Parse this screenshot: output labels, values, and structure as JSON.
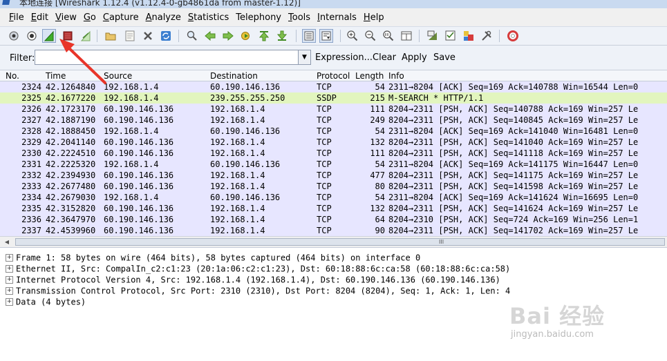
{
  "window": {
    "title": "本地连接 [Wireshark 1.12.4 (v1.12.4-0-gb4861da from master-1.12)]"
  },
  "menu": [
    {
      "underline": "F",
      "rest": "ile"
    },
    {
      "underline": "E",
      "rest": "dit"
    },
    {
      "underline": "V",
      "rest": "iew"
    },
    {
      "underline": "G",
      "rest": "o"
    },
    {
      "underline": "C",
      "rest": "apture"
    },
    {
      "underline": "A",
      "rest": "nalyze"
    },
    {
      "underline": "S",
      "rest": "tatistics"
    },
    {
      "underline": "",
      "rest": "Telephony"
    },
    {
      "underline": "T",
      "rest": "ools"
    },
    {
      "underline": "I",
      "rest": "nternals"
    },
    {
      "underline": "H",
      "rest": "elp"
    }
  ],
  "toolbar": {
    "icons": [
      "interfaces-icon",
      "capture-options-icon",
      "start-capture-icon",
      "stop-capture-icon",
      "restart-capture-icon",
      "open-file-icon",
      "save-file-icon",
      "close-file-icon",
      "reload-icon",
      "find-icon",
      "go-back-icon",
      "go-forward-icon",
      "go-to-packet-icon",
      "go-first-icon",
      "go-last-icon",
      "colorize-icon",
      "autoscroll-icon",
      "zoom-in-icon",
      "zoom-out-icon",
      "zoom-normal-icon",
      "resize-columns-icon",
      "capture-filters-icon",
      "display-filters-icon",
      "coloring-rules-icon",
      "preferences-icon",
      "help-icon"
    ]
  },
  "filter": {
    "label": "Filter:",
    "value": "",
    "expression_label": "Expression...",
    "clear_label": "Clear",
    "apply_label": "Apply",
    "save_label": "Save"
  },
  "packet_list": {
    "columns": [
      "No.",
      "Time",
      "Source",
      "Destination",
      "Protocol",
      "Length",
      "Info"
    ],
    "rows": [
      {
        "no": "2324",
        "time": "42.1264840",
        "src": "192.168.1.4",
        "dst": "60.190.146.136",
        "proto": "TCP",
        "len": "54",
        "info": "2311→8204 [ACK] Seq=169 Ack=140788 Win=16544 Len=0",
        "bg": "#e7e6ff"
      },
      {
        "no": "2325",
        "time": "42.1677220",
        "src": "192.168.1.4",
        "dst": "239.255.255.250",
        "proto": "SSDP",
        "len": "215",
        "info": "M-SEARCH * HTTP/1.1",
        "bg": "#e2f5be"
      },
      {
        "no": "2326",
        "time": "42.1723170",
        "src": "60.190.146.136",
        "dst": "192.168.1.4",
        "proto": "TCP",
        "len": "111",
        "info": "8204→2311 [PSH, ACK] Seq=140788 Ack=169 Win=257 Le",
        "bg": "#e7e6ff"
      },
      {
        "no": "2327",
        "time": "42.1887190",
        "src": "60.190.146.136",
        "dst": "192.168.1.4",
        "proto": "TCP",
        "len": "249",
        "info": "8204→2311 [PSH, ACK] Seq=140845 Ack=169 Win=257 Le",
        "bg": "#e7e6ff"
      },
      {
        "no": "2328",
        "time": "42.1888450",
        "src": "192.168.1.4",
        "dst": "60.190.146.136",
        "proto": "TCP",
        "len": "54",
        "info": "2311→8204 [ACK] Seq=169 Ack=141040 Win=16481 Len=0",
        "bg": "#e7e6ff"
      },
      {
        "no": "2329",
        "time": "42.2041140",
        "src": "60.190.146.136",
        "dst": "192.168.1.4",
        "proto": "TCP",
        "len": "132",
        "info": "8204→2311 [PSH, ACK] Seq=141040 Ack=169 Win=257 Le",
        "bg": "#e7e6ff"
      },
      {
        "no": "2330",
        "time": "42.2224510",
        "src": "60.190.146.136",
        "dst": "192.168.1.4",
        "proto": "TCP",
        "len": "111",
        "info": "8204→2311 [PSH, ACK] Seq=141118 Ack=169 Win=257 Le",
        "bg": "#e7e6ff"
      },
      {
        "no": "2331",
        "time": "42.2225320",
        "src": "192.168.1.4",
        "dst": "60.190.146.136",
        "proto": "TCP",
        "len": "54",
        "info": "2311→8204 [ACK] Seq=169 Ack=141175 Win=16447 Len=0",
        "bg": "#e7e6ff"
      },
      {
        "no": "2332",
        "time": "42.2394930",
        "src": "60.190.146.136",
        "dst": "192.168.1.4",
        "proto": "TCP",
        "len": "477",
        "info": "8204→2311 [PSH, ACK] Seq=141175 Ack=169 Win=257 Le",
        "bg": "#e7e6ff"
      },
      {
        "no": "2333",
        "time": "42.2677480",
        "src": "60.190.146.136",
        "dst": "192.168.1.4",
        "proto": "TCP",
        "len": "80",
        "info": "8204→2311 [PSH, ACK] Seq=141598 Ack=169 Win=257 Le",
        "bg": "#e7e6ff"
      },
      {
        "no": "2334",
        "time": "42.2679030",
        "src": "192.168.1.4",
        "dst": "60.190.146.136",
        "proto": "TCP",
        "len": "54",
        "info": "2311→8204 [ACK] Seq=169 Ack=141624 Win=16695 Len=0",
        "bg": "#e7e6ff"
      },
      {
        "no": "2335",
        "time": "42.3152820",
        "src": "60.190.146.136",
        "dst": "192.168.1.4",
        "proto": "TCP",
        "len": "132",
        "info": "8204→2311 [PSH, ACK] Seq=141624 Ack=169 Win=257 Le",
        "bg": "#e7e6ff"
      },
      {
        "no": "2336",
        "time": "42.3647970",
        "src": "60.190.146.136",
        "dst": "192.168.1.4",
        "proto": "TCP",
        "len": "64",
        "info": "8204→2310 [PSH, ACK] Seq=724 Ack=169 Win=256 Len=1",
        "bg": "#e7e6ff"
      },
      {
        "no": "2337",
        "time": "42.4539960",
        "src": "60.190.146.136",
        "dst": "192.168.1.4",
        "proto": "TCP",
        "len": "90",
        "info": "8204→2311 [PSH, ACK] Seq=141702 Ack=169 Win=257 Le",
        "bg": "#e7e6ff"
      }
    ]
  },
  "scrollbar": {
    "grip": "III"
  },
  "details": [
    "Frame 1: 58 bytes on wire (464 bits), 58 bytes captured (464 bits) on interface 0",
    "Ethernet II, Src: CompalIn_c2:c1:23 (20:1a:06:c2:c1:23), Dst: 60:18:88:6c:ca:58 (60:18:88:6c:ca:58)",
    "Internet Protocol Version 4, Src: 192.168.1.4 (192.168.1.4), Dst: 60.190.146.136 (60.190.146.136)",
    "Transmission Control Protocol, Src Port: 2310 (2310), Dst Port: 8204 (8204), Seq: 1, Ack: 1, Len: 4",
    "Data (4 bytes)"
  ],
  "expander_symbol": "+",
  "watermark": {
    "main": "Bai 经验",
    "sub": "jingyan.baidu.com"
  },
  "colors": {
    "arrow": "#e8352a",
    "start_capture": "#3fae2a",
    "stop_capture": "#b03030"
  }
}
